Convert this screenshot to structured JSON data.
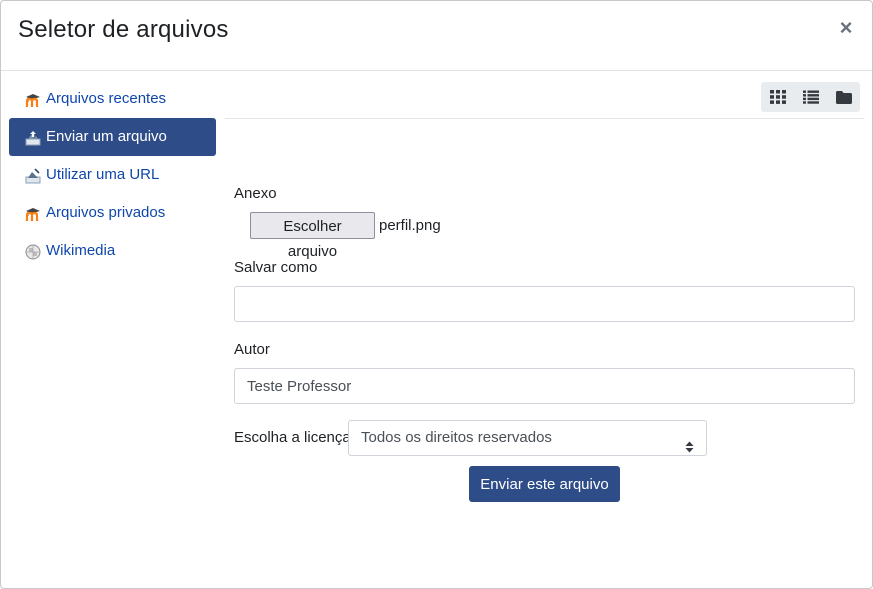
{
  "dialog": {
    "title": "Seletor de arquivos",
    "close_label": "×"
  },
  "sidebar": {
    "items": [
      {
        "label": "Arquivos recentes",
        "icon": "moodle-icon",
        "active": false
      },
      {
        "label": "Enviar um arquivo",
        "icon": "upload-icon",
        "active": true
      },
      {
        "label": "Utilizar uma URL",
        "icon": "url-download-icon",
        "active": false
      },
      {
        "label": "Arquivos privados",
        "icon": "moodle-icon",
        "active": false
      },
      {
        "label": "Wikimedia",
        "icon": "wikimedia-globe-icon",
        "active": false
      }
    ]
  },
  "viewbar": {
    "icons": [
      "grid-view-icon",
      "list-view-icon",
      "folder-view-icon"
    ]
  },
  "form": {
    "attachment_label": "Anexo",
    "choose_file_label": "Escolher arquivo",
    "chosen_filename": "perfil.png",
    "save_as_label": "Salvar como",
    "save_as_value": "",
    "author_label": "Autor",
    "author_value": "Teste Professor",
    "license_label": "Escolha a licença",
    "license_selected": "Todos os direitos reservados",
    "submit_label": "Enviar este arquivo"
  },
  "colors": {
    "primary": "#2d4c88",
    "link": "#0f47ad",
    "moodle_orange": "#f98012"
  }
}
